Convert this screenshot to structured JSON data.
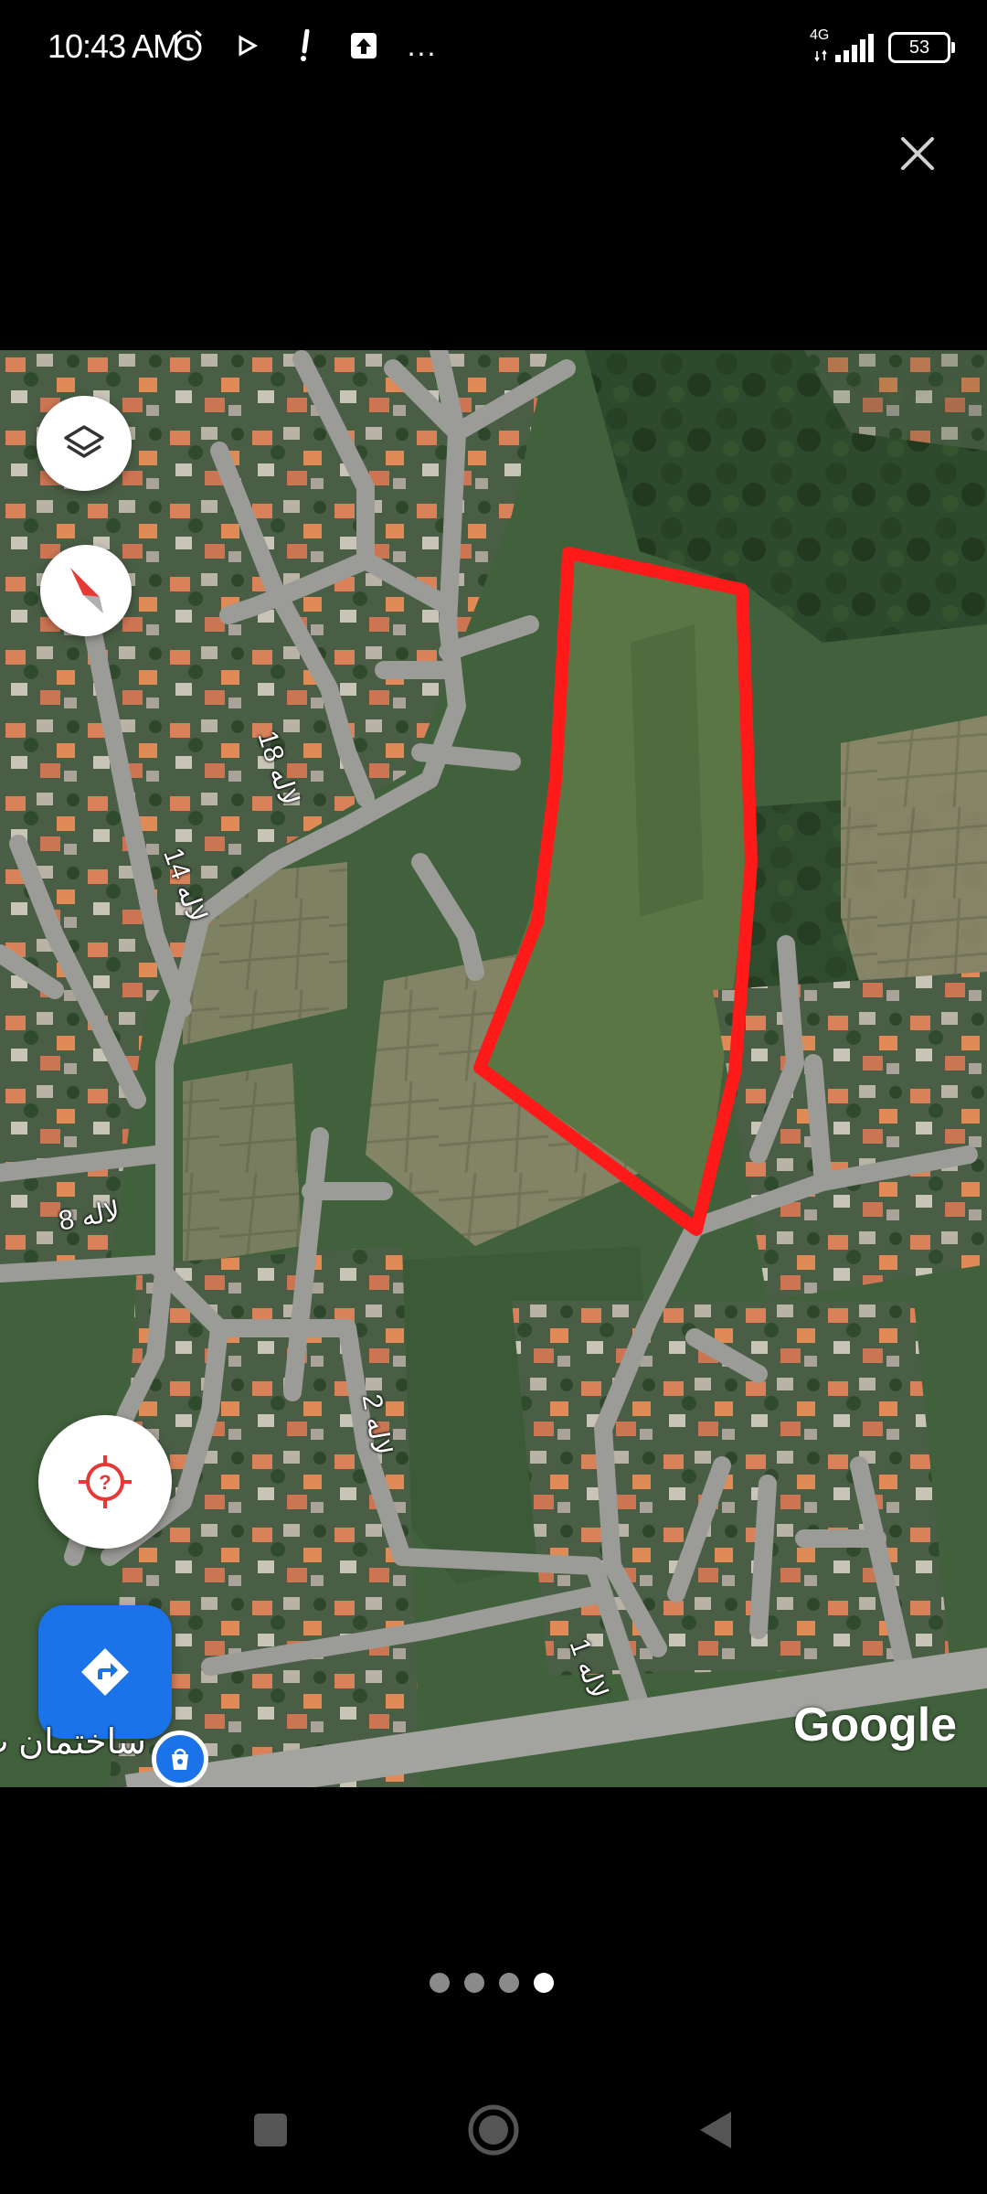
{
  "status_bar": {
    "time": "10:43 AM",
    "network": "4G",
    "battery": "53",
    "more": "..."
  },
  "map": {
    "watermark": "Google",
    "place_label": "ساختمان ت",
    "street_labels": [
      "لاله 18",
      "لاله 14",
      "لاله 8",
      "لاله 2",
      "لاله 1"
    ]
  },
  "pager": {
    "total": 4,
    "active_index": 3
  },
  "icons": {
    "close": "close-icon",
    "layers": "layers-icon",
    "compass": "compass-icon",
    "location": "location-unknown-icon",
    "directions": "directions-icon",
    "shop": "shopping-bag-icon"
  },
  "colors": {
    "boundary": "#ff1a1a",
    "accent": "#1a73e8",
    "background": "#000000"
  }
}
